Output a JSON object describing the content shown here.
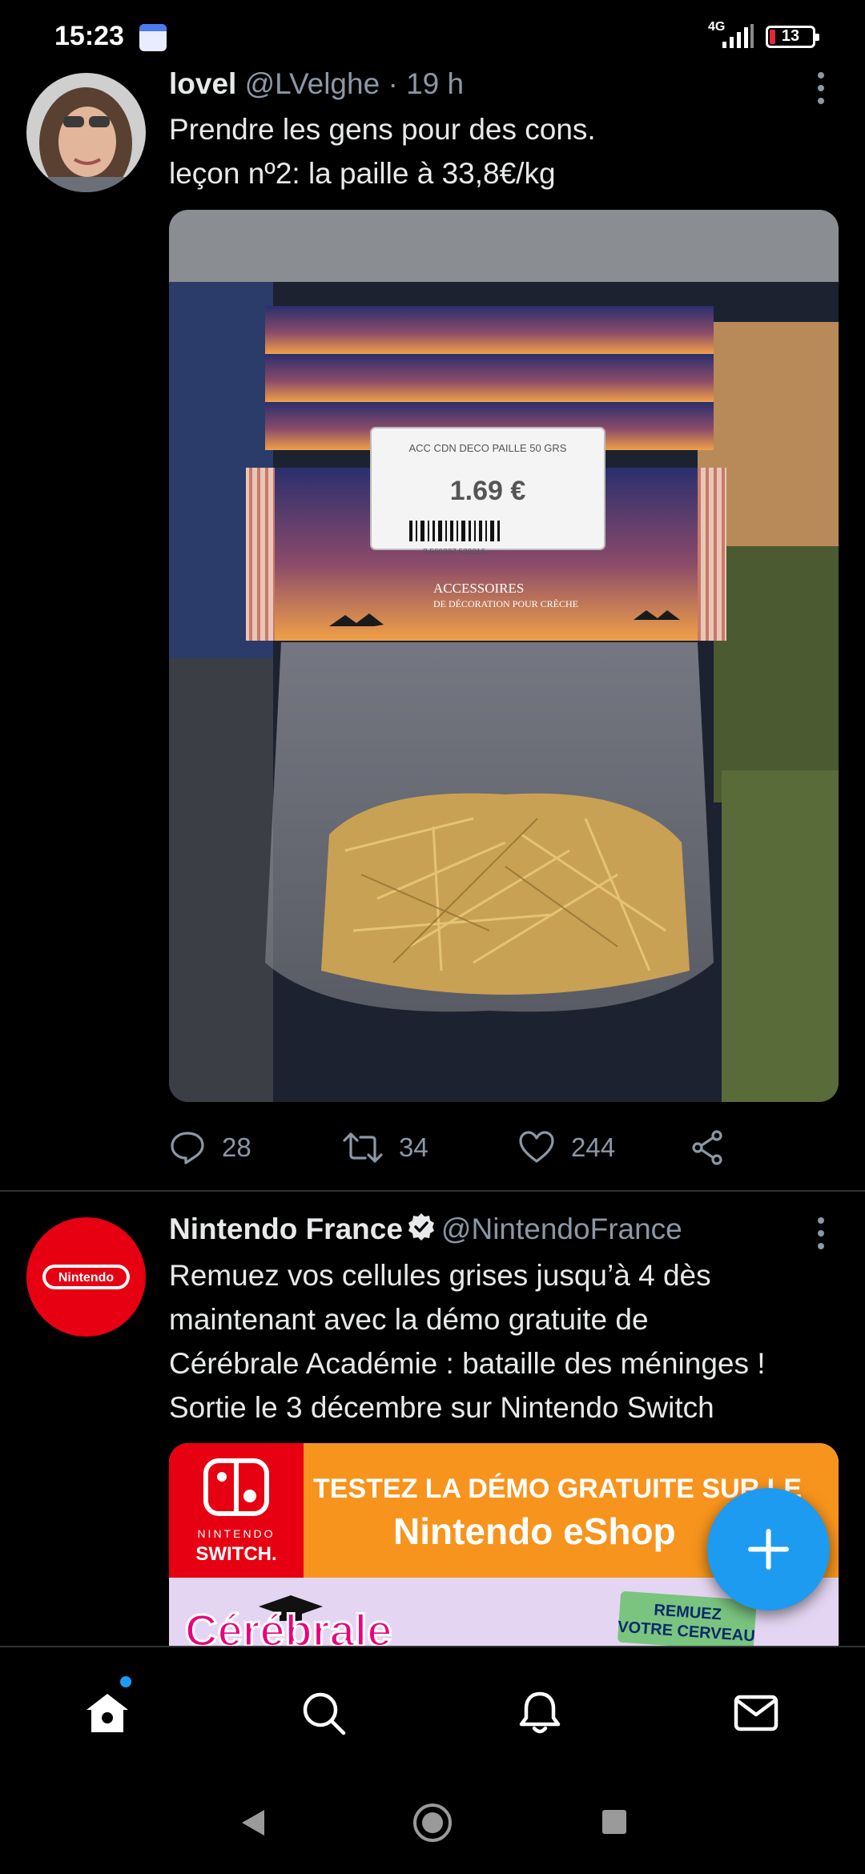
{
  "status_bar": {
    "time": "15:23",
    "network": "4G",
    "battery": "13",
    "battery_level": 0.13,
    "icons": [
      "calendar-icon",
      "signal-icon",
      "battery-icon"
    ]
  },
  "tweets": [
    {
      "name": "lovel",
      "handle": "@LVelghe",
      "separator": "·",
      "time": "19 h",
      "text_lines": [
        "Prendre les gens pour des cons.",
        "leçon nº2: la paille à 33,8€/kg"
      ],
      "media": {
        "price_tag_title": "ACC CDN DECO PAILLE 50 GRS",
        "price": "1.69 €",
        "barcode_number": "3 560237 533216",
        "package_label_line1": "ACCESSOIRES",
        "package_label_line2": "DE DÉCORATION POUR CRÈCHE"
      },
      "actions": {
        "replies": "28",
        "retweets": "34",
        "likes": "244"
      }
    },
    {
      "name": "Nintendo France",
      "handle": "@NintendoFrance",
      "verified": true,
      "avatar_text": "Nintendo",
      "text_lines": [
        "Remuez vos cellules grises jusqu’à 4 dès",
        "maintenant avec la démo gratuite de",
        "Cérébrale Académie : bataille des méninges !",
        "Sortie le 3 décembre sur Nintendo Switch"
      ],
      "media": {
        "logo_line1": "NINTENDO",
        "logo_line2": "SWITCH.",
        "banner_line1": "TESTEZ LA DÉMO GRATUITE SUR LE",
        "banner_line2": "Nintendo eShop",
        "game_title": "Cérébrale",
        "badge_line1": "REMUEZ",
        "badge_line2": "VOTRE CERVEAU"
      }
    }
  ],
  "colors": {
    "background": "#000000",
    "accent": "#1d9bf0",
    "text": "#e7e9ea",
    "muted": "#8b98a5",
    "divider": "#2f3336",
    "nintendo_red": "#e60012",
    "banner_orange": "#f7941d"
  },
  "fab": {
    "icon": "plus-icon"
  },
  "bottom_nav": [
    {
      "icon": "home-icon",
      "active": true,
      "notification_dot": true
    },
    {
      "icon": "search-icon"
    },
    {
      "icon": "bell-icon"
    },
    {
      "icon": "mail-icon"
    }
  ],
  "system_nav": [
    "back-icon",
    "home-circle-icon",
    "recents-icon"
  ]
}
